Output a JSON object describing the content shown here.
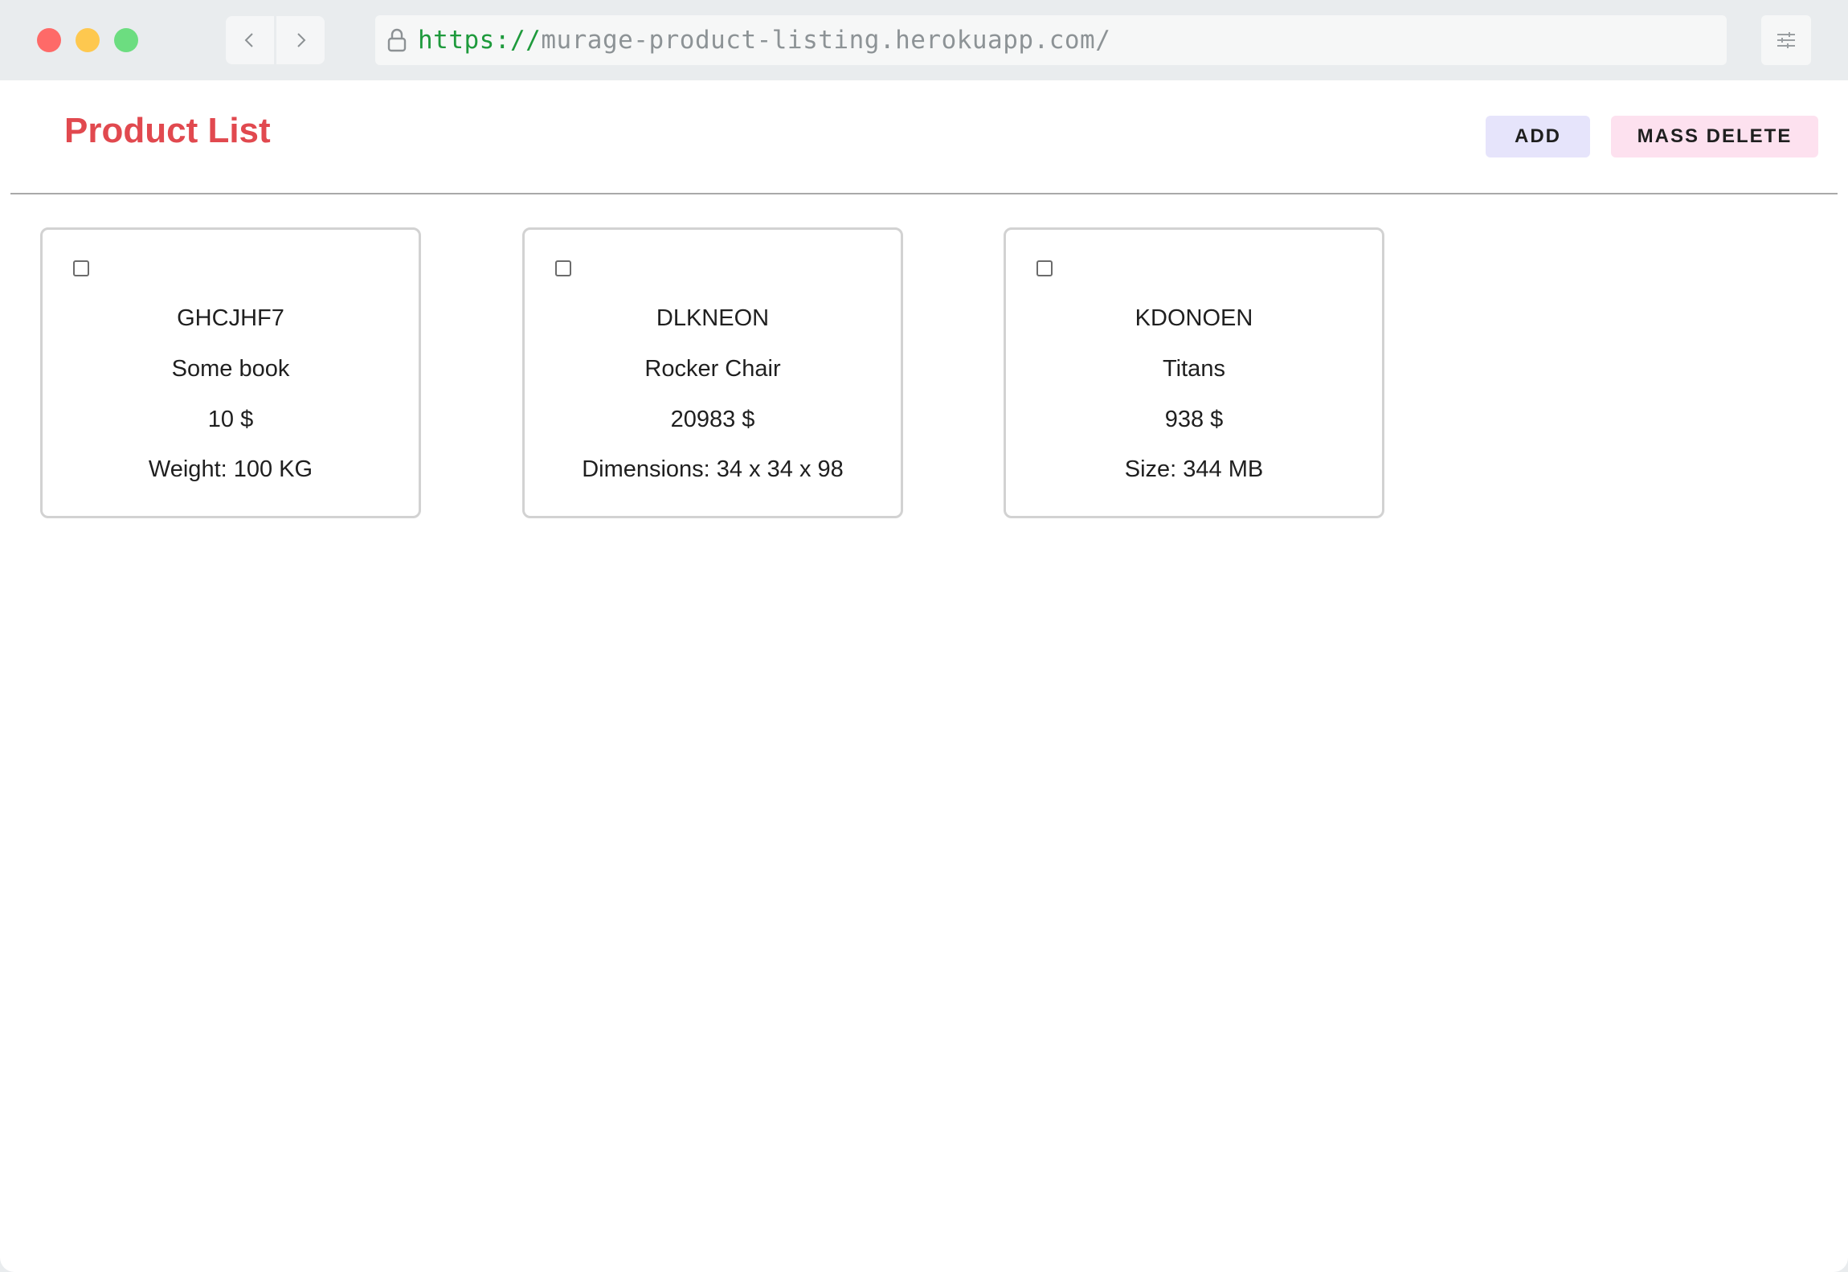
{
  "browser": {
    "url_scheme": "https://",
    "url_host": "murage-product-listing.herokuapp.com/"
  },
  "header": {
    "title": "Product List",
    "add_label": "ADD",
    "mass_delete_label": "MASS DELETE"
  },
  "products": [
    {
      "sku": "GHCJHF7",
      "name": "Some book",
      "price": "10 $",
      "attribute": "Weight: 100 KG",
      "checked": false
    },
    {
      "sku": "DLKNEON",
      "name": "Rocker Chair",
      "price": "20983 $",
      "attribute": "Dimensions: 34 x 34 x 98",
      "checked": false
    },
    {
      "sku": "KDONOEN",
      "name": "Titans",
      "price": "938 $",
      "attribute": "Size: 344 MB",
      "checked": false
    }
  ],
  "colors": {
    "title": "#e1494f",
    "add_button_bg": "#e6e4fb",
    "mass_delete_button_bg": "#fde1ef",
    "url_scheme": "#1e9a3c"
  }
}
